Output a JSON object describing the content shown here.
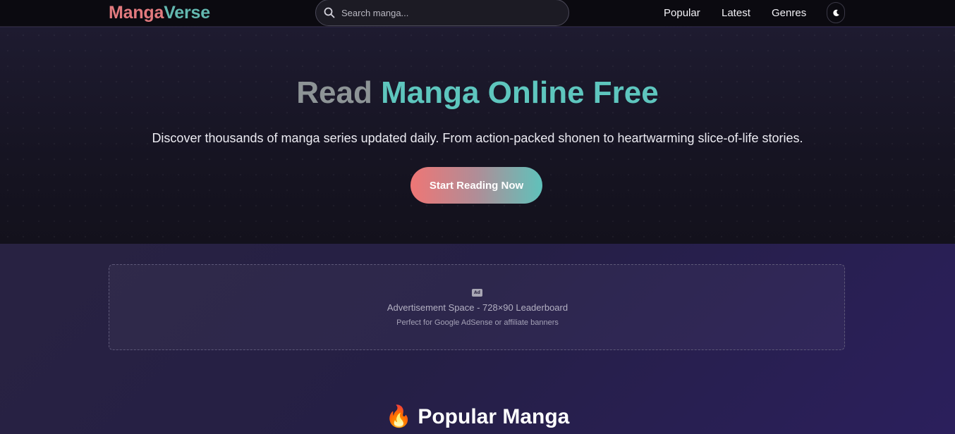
{
  "header": {
    "logo": {
      "part1": "Manga",
      "part2": "Verse"
    },
    "search": {
      "placeholder": "Search manga...",
      "value": ""
    },
    "nav": [
      {
        "label": "Popular"
      },
      {
        "label": "Latest"
      },
      {
        "label": "Genres"
      }
    ],
    "theme_toggle_icon": "moon-icon"
  },
  "hero": {
    "title_part1": "Read",
    "title_part2": "Manga Online Free",
    "subtitle": "Discover thousands of manga series updated daily. From action-packed shonen to heartwarming slice-of-life stories.",
    "cta_label": "Start Reading Now"
  },
  "ad": {
    "icon_label": "Ad",
    "title": "Advertisement Space - 728×90 Leaderboard",
    "description": "Perfect for Google AdSense or affiliate banners"
  },
  "popular": {
    "emoji": "🔥",
    "title": "Popular Manga"
  },
  "colors": {
    "logo_primary": "#e27a7e",
    "logo_secondary": "#63b8b0",
    "accent_teal": "#5ec6be",
    "accent_coral": "#ef7675"
  }
}
